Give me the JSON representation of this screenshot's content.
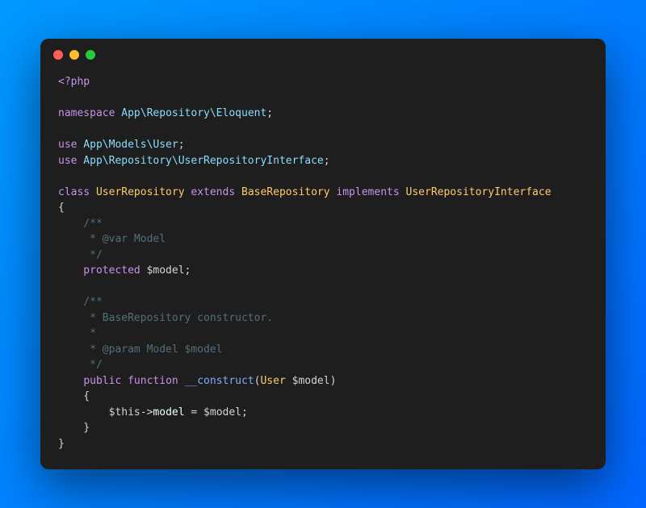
{
  "window": {
    "dots": [
      "red",
      "yellow",
      "green"
    ]
  },
  "code": {
    "l1": {
      "open": "<?",
      "php": "php"
    },
    "l2": {
      "kw": "namespace",
      "ns": " App\\Repository\\Eloquent",
      "semi": ";"
    },
    "l3": {
      "kw": "use",
      "ns": " App\\Models\\User",
      "semi": ";"
    },
    "l4": {
      "kw": "use",
      "ns": " App\\Repository\\UserRepositoryInterface",
      "semi": ";"
    },
    "l5": {
      "kw1": "class",
      "cls1": " UserRepository ",
      "kw2": "extends",
      "cls2": " BaseRepository ",
      "kw3": "implements",
      "cls3": " UserRepositoryInterface"
    },
    "l6": "{",
    "l7": "    /**",
    "l8": "     * @var Model",
    "l9": "     */",
    "l10": {
      "kw": "    protected ",
      "var": "$model",
      "semi": ";"
    },
    "l11": "    /**",
    "l12": "     * BaseRepository constructor.",
    "l13": "     *",
    "l14": "     * @param Model $model",
    "l15": "     */",
    "l16": {
      "indent": "    ",
      "kw1": "public ",
      "kw2": "function ",
      "fn": "__construct",
      "open": "(",
      "type": "User ",
      "param": "$model",
      "close": ")"
    },
    "l17": "    {",
    "l18": {
      "indent": "        ",
      "this": "$this",
      "arrow": "->",
      "prop": "model ",
      "eq": "= ",
      "var": "$model",
      "semi": ";"
    },
    "l19": "    }",
    "l20": "}"
  }
}
